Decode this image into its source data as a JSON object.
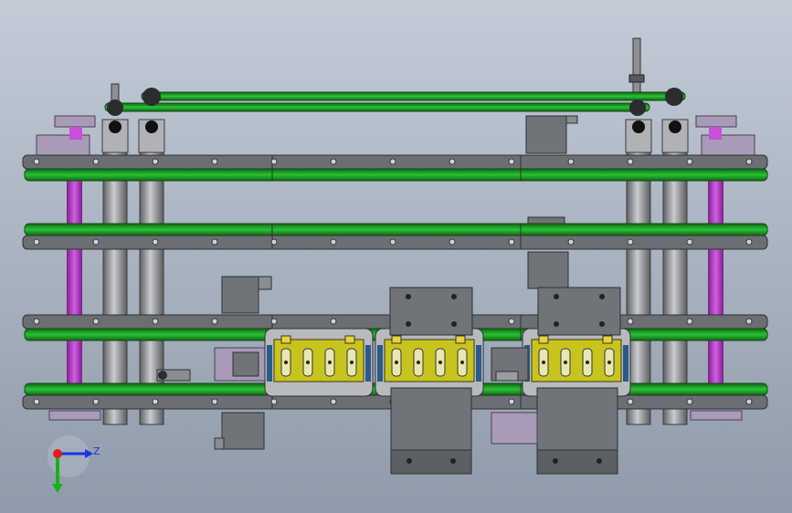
{
  "viewport": {
    "background_top": "#c3cbd7",
    "background_bottom": "#8f9aaa"
  },
  "colors": {
    "rail": "#6b6e72",
    "rail_edge": "#2f3133",
    "belt_green": "#1fa52a",
    "belt_dark": "#0f6614",
    "shaft_purple": "#b43cc8",
    "shaft_grey": "#8e9093",
    "block_grey": "#707377",
    "carrier_grey": "#b8babd",
    "carrier_yellow": "#c8c41e",
    "bracket_lilac": "#a99bb8",
    "axis_x_red": "#e01b1b",
    "axis_y_green": "#19b019",
    "axis_z_blue": "#1b35e0"
  },
  "triad": {
    "axis_z_label": "Z",
    "icons": [
      "coordinate-triad-icon",
      "axis-y-arrow-icon",
      "axis-z-arrow-icon",
      "axis-x-origin-icon"
    ]
  }
}
